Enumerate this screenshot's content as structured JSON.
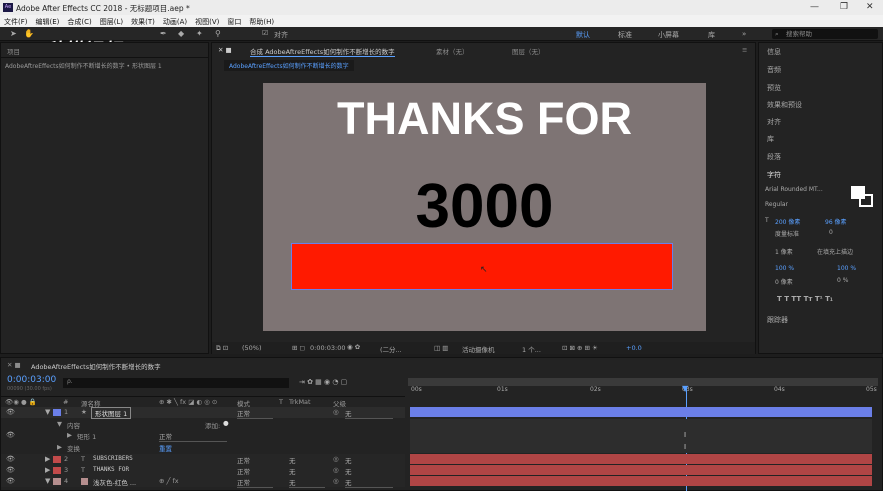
{
  "window": {
    "title": "Adobe After Effects CC 2018 - 无标题项目.aep *",
    "app_icon": "Ae"
  },
  "menu": [
    "文件(F)",
    "编辑(E)",
    "合成(C)",
    "图层(L)",
    "效果(T)",
    "动画(A)",
    "视图(V)",
    "窗口",
    "帮助(H)"
  ],
  "toolbar": {
    "snap_label": "对齐",
    "workspaces": [
      "默认",
      "标准",
      "小屏幕",
      "库"
    ],
    "search_placeholder": "搜索帮助"
  },
  "watermark": "秒懂视频",
  "project_panel": {
    "tab": "项目",
    "breadcrumb": "AdobeAftreEffects如何制作不断增长的数字 • 形状图层 1"
  },
  "comp_panel": {
    "tab": "合成 AdobeAftreEffects如何制作不断增长的数字",
    "tab2": "素材（无）",
    "tab3": "图层（无）",
    "comp_name": "AdobeAftreEffects如何制作不断增长的数字",
    "headline": "THANKS FOR",
    "counter": "3000",
    "shape_color": "#ff1a00"
  },
  "viewer_bar": {
    "zoom": "(50%)",
    "timecode": "0:00:03:00",
    "resolution": "(二分...",
    "camera": "活动摄像机",
    "views": "1 个...",
    "exposure": "+0.0"
  },
  "right_panel": {
    "items": [
      "信息",
      "音频",
      "预览",
      "效果和预设",
      "对齐",
      "库",
      "段落",
      "字符"
    ],
    "font": "Arial Rounded MT...",
    "style": "Regular",
    "size": "200 像素",
    "leading": "96 像素",
    "kerning": "度量标准",
    "tracking": "0",
    "stroke": "1 像素",
    "stroke_mode": "在填充上描边",
    "vscale": "100 %",
    "hscale": "100 %",
    "baseline": "0 像素",
    "tsume": "0 %",
    "tracker": "跟踪器"
  },
  "timeline": {
    "tab": "AdobeAftreEffects如何制作不断增长的数字",
    "timecode": "0:00:03:00",
    "frames": "00090 (30.00 fps)",
    "search_placeholder": "ρ.",
    "headers": {
      "num": "#",
      "name": "源名称",
      "mode": "模式",
      "t": "T",
      "trkmat": "TrkMat",
      "parent": "父级"
    },
    "ruler": [
      "00s",
      "01s",
      "02s",
      "03s",
      "04s",
      "05s"
    ],
    "layers": [
      {
        "num": "1",
        "name": "形状图层 1",
        "mode": "正常",
        "trk": "",
        "parent": "无",
        "color": "#6b7fe8"
      },
      {
        "num": "2",
        "name": "SUBSCRIBERS",
        "mode": "正常",
        "trk": "无",
        "parent": "无",
        "color": "#c24a4a"
      },
      {
        "num": "3",
        "name": "THANKS FOR",
        "mode": "正常",
        "trk": "无",
        "parent": "无",
        "color": "#c24a4a"
      },
      {
        "num": "4",
        "name": "浅灰色-红色 ...",
        "mode": "正常",
        "trk": "无",
        "parent": "无",
        "color": "#b58e8e"
      }
    ],
    "sub": {
      "content": "内容",
      "add": "添加:",
      "rect": "矩形 1",
      "rect_mode": "正常",
      "transform": "变换",
      "reset": "重置"
    }
  }
}
